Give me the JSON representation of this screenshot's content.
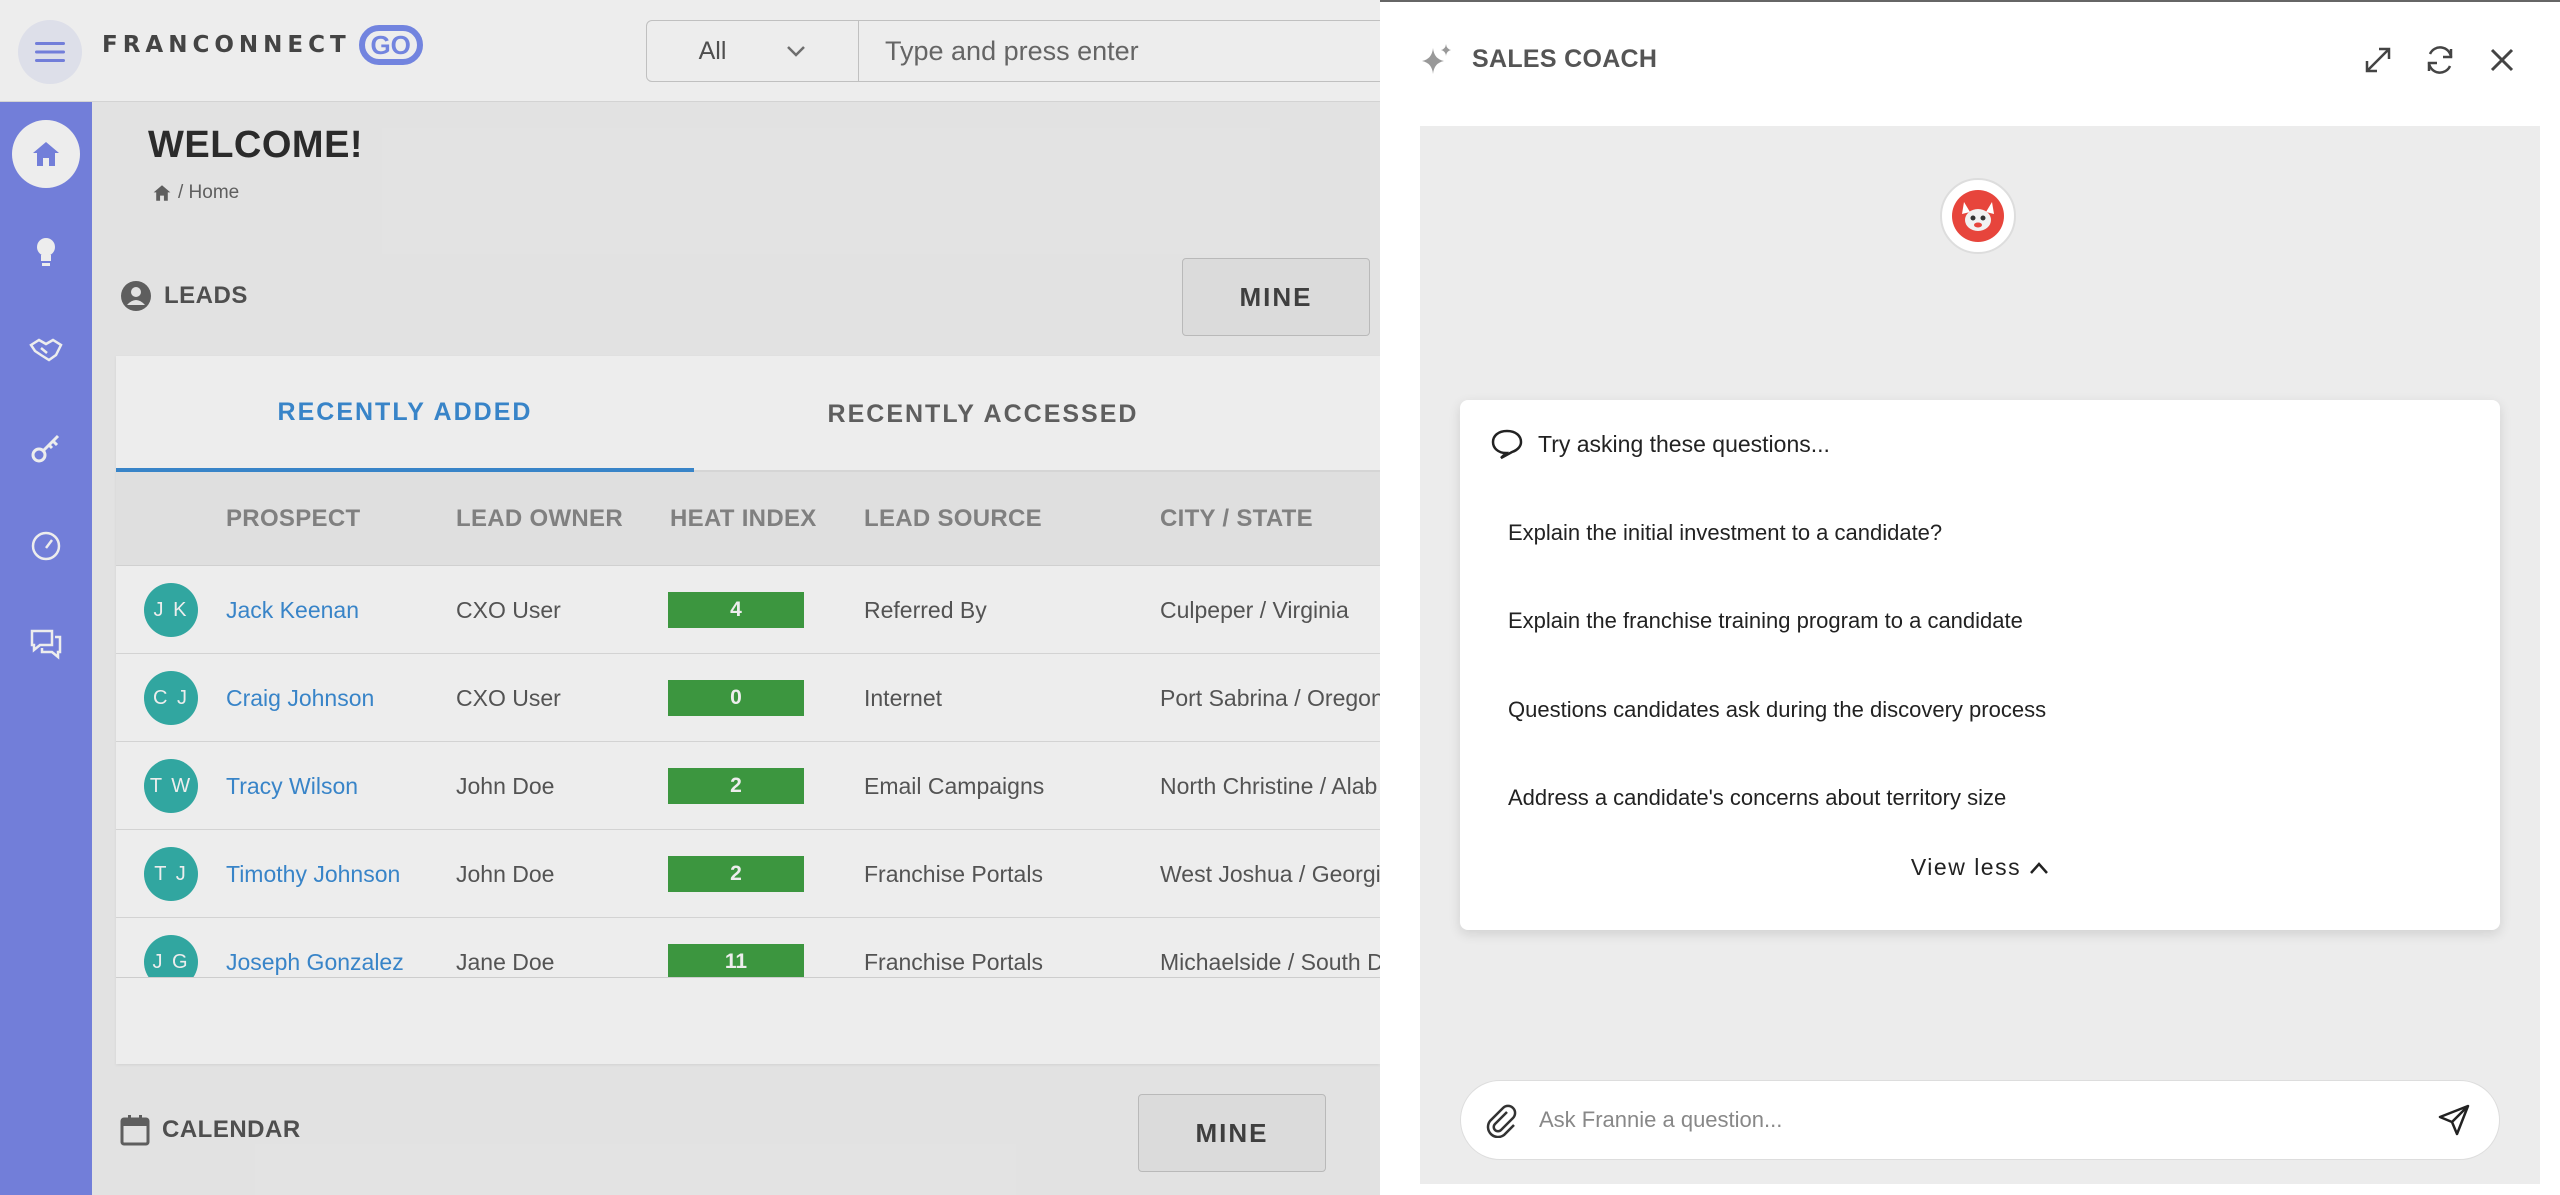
{
  "topbar": {
    "logo_text": "FRANCONNECT",
    "logo_badge": "GO",
    "search_category": "All",
    "search_placeholder": "Type and press enter"
  },
  "sidebar": {
    "items": [
      {
        "icon": "home-icon",
        "active": true
      },
      {
        "icon": "lightbulb-icon",
        "active": false
      },
      {
        "icon": "handshake-icon",
        "active": false
      },
      {
        "icon": "key-icon",
        "active": false
      },
      {
        "icon": "gauge-icon",
        "active": false
      },
      {
        "icon": "chat-icon",
        "active": false
      }
    ]
  },
  "main": {
    "welcome": "WELCOME!",
    "breadcrumb": "/ Home",
    "leads": {
      "title": "LEADS",
      "mine_label": "MINE",
      "tabs": [
        "RECENTLY ADDED",
        "RECENTLY ACCESSED"
      ],
      "columns": [
        "PROSPECT",
        "LEAD OWNER",
        "HEAT INDEX",
        "LEAD SOURCE",
        "CITY / STATE"
      ],
      "rows": [
        {
          "initials": "J K",
          "name": "Jack Keenan",
          "owner": "CXO User",
          "heat": "4",
          "source": "Referred By",
          "city": "Culpeper / Virginia"
        },
        {
          "initials": "C J",
          "name": "Craig Johnson",
          "owner": "CXO User",
          "heat": "0",
          "source": "Internet",
          "city": "Port Sabrina / Oregon"
        },
        {
          "initials": "T W",
          "name": "Tracy Wilson",
          "owner": "John Doe",
          "heat": "2",
          "source": "Email Campaigns",
          "city": "North Christine / Alab"
        },
        {
          "initials": "T J",
          "name": "Timothy Johnson",
          "owner": "John Doe",
          "heat": "2",
          "source": "Franchise Portals",
          "city": "West Joshua / Georgi"
        },
        {
          "initials": "J G",
          "name": "Joseph Gonzalez",
          "owner": "Jane Doe",
          "heat": "11",
          "source": "Franchise Portals",
          "city": "Michaelside / South D"
        }
      ]
    },
    "calendar": {
      "title": "CALENDAR",
      "mine_label": "MINE"
    }
  },
  "panel": {
    "title": "SALES COACH",
    "suggest_heading": "Try asking these questions...",
    "questions": [
      "Explain the initial investment to a candidate?",
      "Explain the franchise training program to a candidate",
      "Questions candidates ask during the discovery process",
      "Address a candidate's concerns about territory size"
    ],
    "view_less": "View less",
    "ask_placeholder": "Ask Frannie a question..."
  },
  "colors": {
    "sidebar": "#7b88ea",
    "accent_blue": "#3d8fd8",
    "heat_green": "#41a244",
    "avatar_teal": "#35b3ad"
  }
}
